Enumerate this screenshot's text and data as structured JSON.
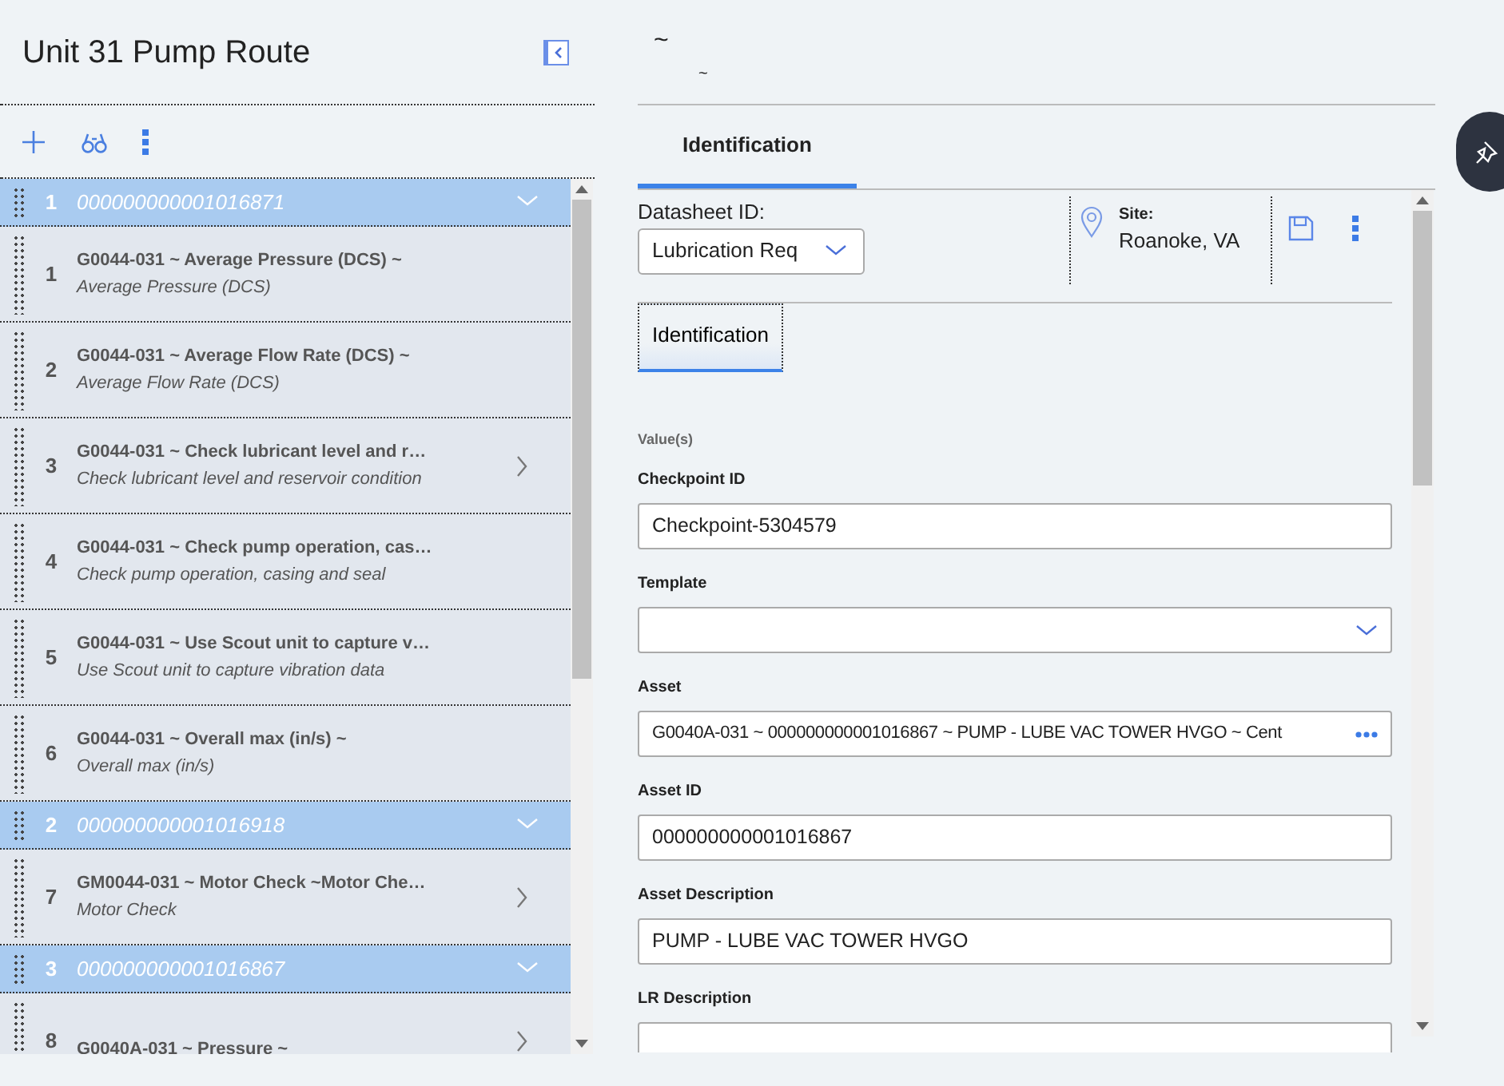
{
  "route": {
    "title": "Unit 31 Pump Route"
  },
  "route_list": [
    {
      "kind": "group",
      "number": "1",
      "label": "000000000001016871",
      "expanded": true
    },
    {
      "kind": "item",
      "number": "1",
      "title": "G0044-031 ~ Average Pressure (DCS) ~",
      "subtitle": "Average Pressure (DCS)",
      "has_details": false
    },
    {
      "kind": "item",
      "number": "2",
      "title": "G0044-031 ~ Average Flow Rate (DCS) ~",
      "subtitle": "Average Flow Rate (DCS)",
      "has_details": false
    },
    {
      "kind": "item",
      "number": "3",
      "title": "G0044-031 ~ Check lubricant level and r…",
      "subtitle": "Check lubricant level and reservoir condition",
      "has_details": true
    },
    {
      "kind": "item",
      "number": "4",
      "title": "G0044-031 ~ Check pump operation, cas…",
      "subtitle": "Check pump operation, casing and seal",
      "has_details": false
    },
    {
      "kind": "item",
      "number": "5",
      "title": "G0044-031 ~ Use Scout unit to capture v…",
      "subtitle": "Use Scout unit to capture vibration data",
      "has_details": false
    },
    {
      "kind": "item",
      "number": "6",
      "title": "G0044-031 ~ Overall max (in/s) ~",
      "subtitle": "Overall max (in/s)",
      "has_details": false
    },
    {
      "kind": "group",
      "number": "2",
      "label": "000000000001016918",
      "expanded": true
    },
    {
      "kind": "item",
      "number": "7",
      "title": "GM0044-031 ~ Motor Check ~Motor Che…",
      "subtitle": "Motor Check",
      "has_details": true
    },
    {
      "kind": "group",
      "number": "3",
      "label": "000000000001016867",
      "expanded": true
    },
    {
      "kind": "item",
      "number": "8",
      "title": "G0040A-031 ~ Pressure ~",
      "has_details": true
    }
  ],
  "record": {
    "title": "~",
    "subtitle": "~"
  },
  "tabs": [
    {
      "label": "Identification",
      "selected": true
    }
  ],
  "datasheet": {
    "label": "Datasheet ID:",
    "value": "Lubrication Req"
  },
  "site": {
    "label": "Site:",
    "value": "Roanoke, VA"
  },
  "section_tabs": [
    {
      "label": "Identification",
      "selected": true
    }
  ],
  "section_heading": "Value(s)",
  "fields": [
    {
      "label": "Checkpoint ID",
      "kind": "text",
      "value": "Checkpoint-5304579"
    },
    {
      "label": "Template",
      "kind": "select"
    },
    {
      "label": "Asset",
      "kind": "lookup",
      "value": "G0040A-031 ~ 000000000001016867 ~ PUMP - LUBE VAC TOWER HVGO ~ Cent"
    },
    {
      "label": "Asset ID",
      "kind": "text",
      "value": "000000000001016867"
    },
    {
      "label": "Asset Description",
      "kind": "text",
      "value": "PUMP - LUBE VAC TOWER HVGO"
    },
    {
      "label": "LR Description",
      "kind": "text"
    }
  ]
}
